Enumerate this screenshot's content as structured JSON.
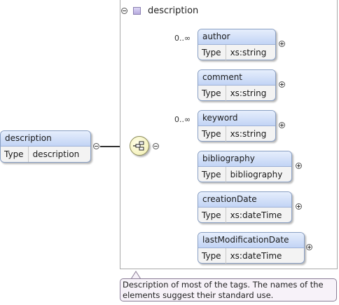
{
  "root": {
    "name": "description",
    "type_label": "Type",
    "type_value": "description"
  },
  "group": {
    "title": "description",
    "icon": "attribute-group-icon"
  },
  "compositor": {
    "kind": "sequence",
    "icon": "sequence-compositor-icon"
  },
  "elements": [
    {
      "name": "author",
      "type_label": "Type",
      "type_value": "xs:string",
      "occurs": "0..∞"
    },
    {
      "name": "comment",
      "type_label": "Type",
      "type_value": "xs:string",
      "occurs": ""
    },
    {
      "name": "keyword",
      "type_label": "Type",
      "type_value": "xs:string",
      "occurs": "0..∞"
    },
    {
      "name": "bibliography",
      "type_label": "Type",
      "type_value": "bibliography",
      "occurs": ""
    },
    {
      "name": "creationDate",
      "type_label": "Type",
      "type_value": "xs:dateTime",
      "occurs": ""
    },
    {
      "name": "lastModificationDate",
      "type_label": "Type",
      "type_value": "xs:dateTime",
      "occurs": ""
    }
  ],
  "tooltip": {
    "text": "Description of most of the tags. The names of the elements suggest their standard use."
  },
  "colors": {
    "node_header": "#c2d4f5",
    "node_border": "#8aa0c4",
    "compositor_fill": "#f2eeb0",
    "tooltip_bg": "#f7f2f9"
  }
}
